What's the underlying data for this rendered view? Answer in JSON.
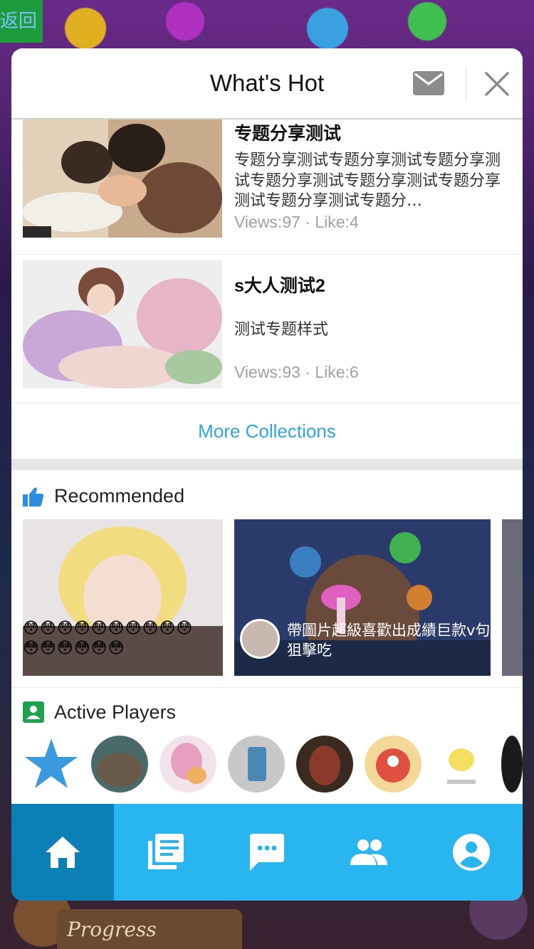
{
  "back_label": "返回",
  "background_text": "Progress",
  "dialog": {
    "title": "What's Hot"
  },
  "collections": [
    {
      "title": "专题分享测试",
      "description": "专题分享测试专题分享测试专题分享测试专题分享测试专题分享测试专题分享测试专题分享测试专题分…",
      "stats": "Views:97 · Like:4"
    },
    {
      "title": "s大人测试2",
      "description": "测试专题样式",
      "stats": "Views:93 · Like:6"
    }
  ],
  "more_collections_label": "More Collections",
  "recommended": {
    "title": "Recommended",
    "items": [
      {
        "caption": "😳😳😳😳😳😳😳😳😳😳😳😳😳😳😳😳"
      },
      {
        "caption": "帶圖片超級喜歡出成績巨款v句狙擊吃"
      }
    ]
  },
  "active_players": {
    "title": "Active Players",
    "avatars": [
      "star",
      "hippo",
      "anime-girl",
      "cup",
      "warrior",
      "monster",
      "chick",
      "dark"
    ]
  },
  "tabbar": {
    "items": [
      {
        "icon": "home-icon",
        "active": true
      },
      {
        "icon": "collections-icon",
        "active": false
      },
      {
        "icon": "chat-icon",
        "active": false
      },
      {
        "icon": "friends-icon",
        "active": false
      },
      {
        "icon": "profile-icon",
        "active": false
      }
    ]
  },
  "colors": {
    "accent": "#29b6f0",
    "accent_dark": "#0c7fb6",
    "link": "#2ea6e6",
    "thumb_up": "#2a8de0",
    "players_icon": "#20a050"
  }
}
